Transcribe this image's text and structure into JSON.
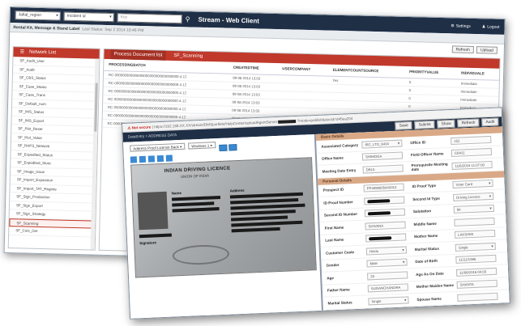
{
  "back": {
    "topbar": {
      "select1": "Jaltal_region",
      "select2": "Incident id",
      "search_placeholder": "Key",
      "title": "Stream - Web Client",
      "settings_label": "Settings",
      "logout_label": "Logout"
    },
    "breadcrumb": {
      "title": "Rental Kit, Message & Stand Label",
      "subtitle": "Last Status: Sep 2 2014 10:46 PM"
    },
    "buttons": {
      "refresh": "Refresh",
      "upload": "Upload"
    },
    "left_panel": {
      "header": "Network List",
      "items": [
        "SF_Audit_User",
        "SF_Audit",
        "SF_CBS_Status",
        "SF_Case_Status",
        "SF_Case_Trans",
        "SF_Default_num",
        "SF_IMS_Status",
        "SF_IMS_Export",
        "SF_Plot_Reset",
        "SF_Plot_Value",
        "SF_RAPS_Network",
        "SF_Expedited_Status",
        "SF_Expedited_Store",
        "SF_Image_Issue",
        "SF_Import_Expansion",
        "SF_Import_TAT_Regime",
        "SF_Sign_Production",
        "SF_Sign_Export",
        "SF_Sign_Strategy",
        "SF_Scanning",
        "SF_Cuts_Det"
      ],
      "selected_index": 19
    },
    "right_panel": {
      "tabs": [
        "Process Document list",
        "SF_Scanning"
      ],
      "columns": [
        "PROCESSINGBATCH",
        "CREATEDTIME",
        "USERCOMPANY",
        "ELEMENTCOUNTSOURCE",
        "PRIORITYVALUE",
        "INDIVIDUALE"
      ],
      "rows": [
        [
          "RC-000000000000000000000000000000000-4-12",
          "09-08-2014 13:03",
          "",
          "Yes",
          "0",
          "Immediate"
        ],
        [
          "RC-000000000000000000000000000000000-4-12",
          "09-08-2014 13:03",
          "",
          "",
          "0",
          "Immediate"
        ],
        [
          "RC-000000000000000000000000000000000-4-12",
          "09-08-2014 13:03",
          "",
          "",
          "0",
          "Immediate"
        ],
        [
          "RC-000000000000000000000000000000000-4-12",
          "09-08-2014 13:03",
          "",
          "",
          "0",
          "Immediate"
        ],
        [
          "RC-000000000000000000000000000000000-4-12",
          "09-08-2014 13:03",
          "",
          "",
          "0",
          "Immediate"
        ],
        [
          "RC-000000000000000000000000000000000-4-12",
          "09-08-2014 13:03",
          "",
          "",
          "0",
          "Immediate"
        ],
        [
          "RC-000000000000000000000000000000000-4-12",
          "09-08-2014 13:03",
          "",
          "",
          "0",
          "Immediate"
        ]
      ]
    }
  },
  "front": {
    "url": {
      "not_secure": "Not secure",
      "path": "https://192.168.XX.XX/stream/DMSportlets/HelpCenter/uploadAgentServer",
      "suffix": "?mode=publish&docId=d45ea204"
    },
    "toolbar": {
      "label": "DataEntry > ADDRESS DATA",
      "buttons": [
        "Save",
        "Submit",
        "Show",
        "Refresh",
        "Audit"
      ]
    },
    "doc_viewer": {
      "select_label": "Address Proof License Back",
      "zoom_label": "Windows 1",
      "card_title": "INDIAN DRIVING LICENCE",
      "card_subtitle": "UNION OF INDIA",
      "card_address_label": "Address",
      "card_name_label": "Name",
      "card_sign_label": "Signature"
    },
    "form": {
      "section1": "Basic Details",
      "section2": "Personal Details",
      "rows1": [
        {
          "l1": "Associated Category",
          "v1": "IRC_LTD_6404",
          "d1": true,
          "l2": "Office ID",
          "v2": "152"
        },
        {
          "l1": "Office Name",
          "v1": "SHIMOGA",
          "d1": false,
          "l2": "Field Officer Name",
          "v2": "CB411"
        },
        {
          "l1": "Meeting Date Entry",
          "v1": "DBL5",
          "d1": false,
          "l2": "Prerequisite Meeting date",
          "v2": "11/6/2016 11:07:00"
        }
      ],
      "rows2": [
        {
          "l1": "Prospect ID",
          "v1": "PP4098005443312",
          "r1": false,
          "d1": false,
          "l2": "ID Proof Type",
          "v2": "Voter Card",
          "d2": true
        },
        {
          "l1": "ID Proof Number",
          "v1": "",
          "r1": true,
          "d1": false,
          "l2": "Second Id Type",
          "v2": "Driving Licence",
          "d2": true
        },
        {
          "l1": "Second ID Number",
          "v1": "",
          "r1": true,
          "d1": false,
          "l2": "Salutation",
          "v2": "Mr",
          "d2": true
        },
        {
          "l1": "First Name",
          "v1": "SHIVANA",
          "r1": false,
          "d1": false,
          "l2": "Middle Name",
          "v2": "",
          "d2": false
        },
        {
          "l1": "Last Name",
          "v1": "",
          "r1": true,
          "d1": false,
          "l2": "Mother Name",
          "v2": "LAKSHMI",
          "d2": false
        },
        {
          "l1": "Customer Caste",
          "v1": "Hindu",
          "r1": false,
          "d1": true,
          "l2": "Marital Status",
          "v2": "Single",
          "d2": true
        },
        {
          "l1": "Gender",
          "v1": "Male",
          "r1": false,
          "d1": true,
          "l2": "Date of Birth",
          "v2": "11/11/1986",
          "d2": false
        },
        {
          "l1": "Age",
          "v1": "29",
          "r1": false,
          "d1": false,
          "l2": "Age As On Date",
          "v2": "11/06/2016 04:03",
          "d2": false
        },
        {
          "l1": "Father Name",
          "v1": "SUGANCHANDRA",
          "r1": false,
          "d1": false,
          "l2": "Mother Maiden Name",
          "v2": "SHANTA",
          "d2": false
        },
        {
          "l1": "Marital Status",
          "v1": "Single",
          "r1": false,
          "d1": true,
          "l2": "Spouse Name",
          "v2": "",
          "d2": false
        }
      ]
    }
  },
  "colors": {
    "header_bg": "#1f2f46",
    "panel_header": "#c0392b",
    "section_bg": "#d9a987"
  }
}
